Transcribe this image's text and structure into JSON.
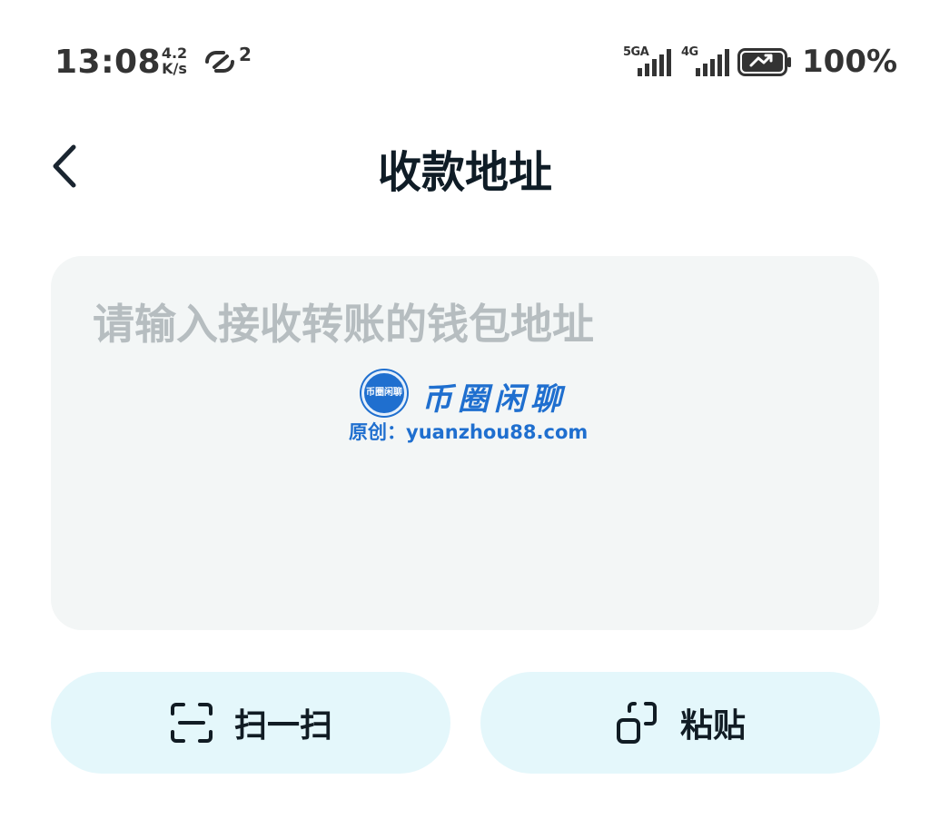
{
  "status_bar": {
    "time": "13:08",
    "net_speed_value": "4.2",
    "net_speed_unit": "K/s",
    "link_count": "2",
    "signal_1_label": "5GA",
    "signal_2_label": "4G",
    "battery_level": "100%",
    "icons": [
      "link-icon",
      "signal-icon",
      "battery-charging-icon"
    ]
  },
  "header": {
    "back_icon": "chevron-left-icon",
    "title": "收款地址"
  },
  "address_input": {
    "value": "",
    "placeholder": "请输入接收转账的钱包地址"
  },
  "watermark": {
    "logo_text": "币圈闲聊",
    "name": "币圈闲聊",
    "url_line": "原创：yuanzhou88.com"
  },
  "actions": {
    "scan_label": "扫一扫",
    "scan_icon": "scan-icon",
    "paste_label": "粘贴",
    "paste_icon": "paste-icon"
  },
  "colors": {
    "input_background": "#f3f6f6",
    "button_background": "#e4f7fb",
    "placeholder": "#b6bdc0",
    "watermark_blue": "#1f6fcf"
  }
}
